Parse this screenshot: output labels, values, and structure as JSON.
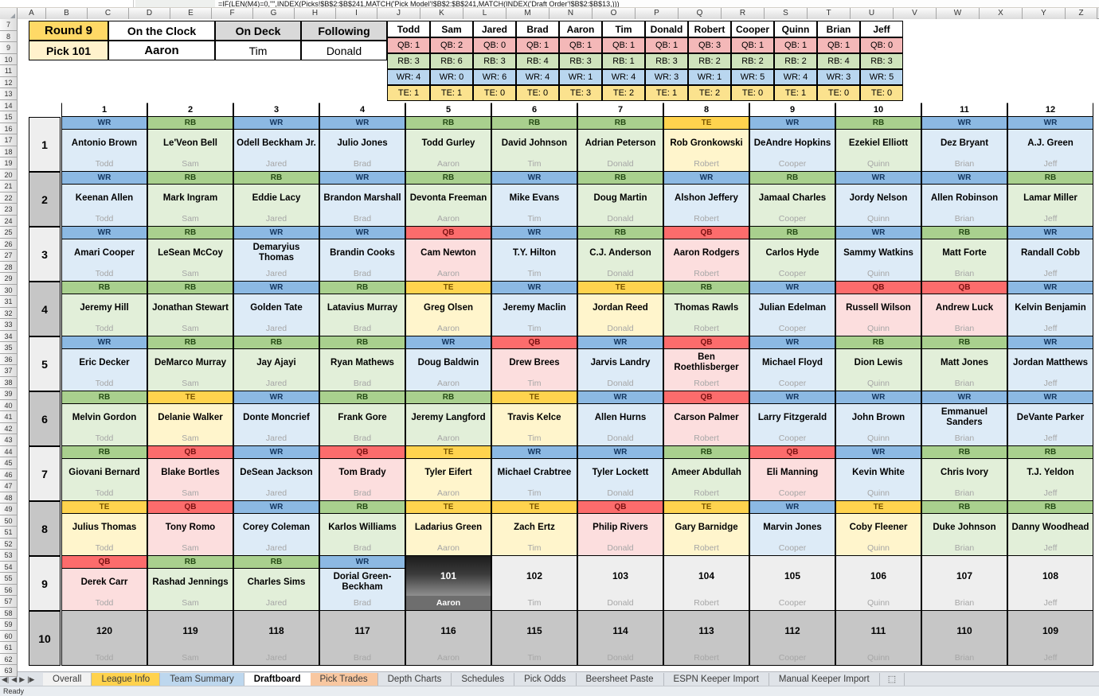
{
  "app": {
    "formula_text": "=IF(LEN(M4)=0,\"\",INDEX(Picks!$B$2:$B$241,MATCH('Pick Model'!$B$2:$B$241,MATCH(INDEX('Draft Order'!$B$2:$B$13,)))"
  },
  "columns": [
    "A",
    "B",
    "C",
    "D",
    "E",
    "F",
    "G",
    "H",
    "I",
    "J",
    "K",
    "L",
    "M",
    "N",
    "O",
    "P",
    "Q",
    "R",
    "S",
    "T",
    "U",
    "V",
    "W",
    "X",
    "Y",
    "Z"
  ],
  "status": {
    "round_label": "Round 9",
    "pick_label": "Pick 101",
    "on_the_clock_label": "On the Clock",
    "on_deck_label": "On Deck",
    "following_label": "Following",
    "on_the_clock_value": "Aaron",
    "on_deck_value": "Tim",
    "following_value": "Donald"
  },
  "roster_summary": {
    "owners": [
      "Todd",
      "Sam",
      "Jared",
      "Brad",
      "Aaron",
      "Tim",
      "Donald",
      "Robert",
      "Cooper",
      "Quinn",
      "Brian",
      "Jeff"
    ],
    "rows": [
      {
        "pos": "QB",
        "values": [
          "QB: 1",
          "QB: 2",
          "QB: 0",
          "QB: 1",
          "QB: 1",
          "QB: 1",
          "QB: 1",
          "QB: 3",
          "QB: 1",
          "QB: 1",
          "QB: 1",
          "QB: 0"
        ]
      },
      {
        "pos": "RB",
        "values": [
          "RB: 3",
          "RB: 6",
          "RB: 3",
          "RB: 4",
          "RB: 3",
          "RB: 1",
          "RB: 3",
          "RB: 2",
          "RB: 2",
          "RB: 2",
          "RB: 4",
          "RB: 3"
        ]
      },
      {
        "pos": "WR",
        "values": [
          "WR: 4",
          "WR: 0",
          "WR: 6",
          "WR: 4",
          "WR: 1",
          "WR: 4",
          "WR: 3",
          "WR: 1",
          "WR: 5",
          "WR: 4",
          "WR: 3",
          "WR: 5"
        ]
      },
      {
        "pos": "TE",
        "values": [
          "TE: 1",
          "TE: 1",
          "TE: 0",
          "TE: 0",
          "TE: 3",
          "TE: 2",
          "TE: 1",
          "TE: 2",
          "TE: 0",
          "TE: 1",
          "TE: 0",
          "TE: 0"
        ]
      }
    ]
  },
  "draftboard": {
    "column_numbers": [
      "1",
      "2",
      "3",
      "4",
      "5",
      "6",
      "7",
      "8",
      "9",
      "10",
      "11",
      "12"
    ],
    "owners": [
      "Todd",
      "Sam",
      "Jared",
      "Brad",
      "Aaron",
      "Tim",
      "Donald",
      "Robert",
      "Cooper",
      "Quinn",
      "Brian",
      "Jeff"
    ],
    "rounds": [
      {
        "round": "1",
        "picks": [
          {
            "pos": "WR",
            "name": "Antonio Brown",
            "owner": "Todd"
          },
          {
            "pos": "RB",
            "name": "Le'Veon Bell",
            "owner": "Sam"
          },
          {
            "pos": "WR",
            "name": "Odell Beckham Jr.",
            "owner": "Jared"
          },
          {
            "pos": "WR",
            "name": "Julio Jones",
            "owner": "Brad"
          },
          {
            "pos": "RB",
            "name": "Todd Gurley",
            "owner": "Aaron"
          },
          {
            "pos": "RB",
            "name": "David Johnson",
            "owner": "Tim"
          },
          {
            "pos": "RB",
            "name": "Adrian Peterson",
            "owner": "Donald"
          },
          {
            "pos": "TE",
            "name": "Rob Gronkowski",
            "owner": "Robert"
          },
          {
            "pos": "WR",
            "name": "DeAndre Hopkins",
            "owner": "Cooper"
          },
          {
            "pos": "RB",
            "name": "Ezekiel Elliott",
            "owner": "Quinn"
          },
          {
            "pos": "WR",
            "name": "Dez Bryant",
            "owner": "Brian"
          },
          {
            "pos": "WR",
            "name": "A.J. Green",
            "owner": "Jeff"
          }
        ]
      },
      {
        "round": "2",
        "picks": [
          {
            "pos": "WR",
            "name": "Keenan Allen",
            "owner": "Todd"
          },
          {
            "pos": "RB",
            "name": "Mark Ingram",
            "owner": "Sam"
          },
          {
            "pos": "RB",
            "name": "Eddie Lacy",
            "owner": "Jared"
          },
          {
            "pos": "WR",
            "name": "Brandon Marshall",
            "owner": "Brad"
          },
          {
            "pos": "RB",
            "name": "Devonta Freeman",
            "owner": "Aaron"
          },
          {
            "pos": "WR",
            "name": "Mike Evans",
            "owner": "Tim"
          },
          {
            "pos": "RB",
            "name": "Doug Martin",
            "owner": "Donald"
          },
          {
            "pos": "WR",
            "name": "Alshon Jeffery",
            "owner": "Robert"
          },
          {
            "pos": "RB",
            "name": "Jamaal Charles",
            "owner": "Cooper"
          },
          {
            "pos": "WR",
            "name": "Jordy Nelson",
            "owner": "Quinn"
          },
          {
            "pos": "WR",
            "name": "Allen Robinson",
            "owner": "Brian"
          },
          {
            "pos": "RB",
            "name": "Lamar Miller",
            "owner": "Jeff"
          }
        ]
      },
      {
        "round": "3",
        "picks": [
          {
            "pos": "WR",
            "name": "Amari Cooper",
            "owner": "Todd"
          },
          {
            "pos": "RB",
            "name": "LeSean McCoy",
            "owner": "Sam"
          },
          {
            "pos": "WR",
            "name": "Demaryius Thomas",
            "owner": "Jared"
          },
          {
            "pos": "WR",
            "name": "Brandin Cooks",
            "owner": "Brad"
          },
          {
            "pos": "QB",
            "name": "Cam Newton",
            "owner": "Aaron"
          },
          {
            "pos": "WR",
            "name": "T.Y. Hilton",
            "owner": "Tim"
          },
          {
            "pos": "RB",
            "name": "C.J. Anderson",
            "owner": "Donald"
          },
          {
            "pos": "QB",
            "name": "Aaron Rodgers",
            "owner": "Robert"
          },
          {
            "pos": "RB",
            "name": "Carlos Hyde",
            "owner": "Cooper"
          },
          {
            "pos": "WR",
            "name": "Sammy Watkins",
            "owner": "Quinn"
          },
          {
            "pos": "RB",
            "name": "Matt Forte",
            "owner": "Brian"
          },
          {
            "pos": "WR",
            "name": "Randall Cobb",
            "owner": "Jeff"
          }
        ]
      },
      {
        "round": "4",
        "picks": [
          {
            "pos": "RB",
            "name": "Jeremy Hill",
            "owner": "Todd"
          },
          {
            "pos": "RB",
            "name": "Jonathan Stewart",
            "owner": "Sam"
          },
          {
            "pos": "WR",
            "name": "Golden Tate",
            "owner": "Jared"
          },
          {
            "pos": "RB",
            "name": "Latavius Murray",
            "owner": "Brad"
          },
          {
            "pos": "TE",
            "name": "Greg Olsen",
            "owner": "Aaron"
          },
          {
            "pos": "WR",
            "name": "Jeremy Maclin",
            "owner": "Tim"
          },
          {
            "pos": "TE",
            "name": "Jordan Reed",
            "owner": "Donald"
          },
          {
            "pos": "RB",
            "name": "Thomas Rawls",
            "owner": "Robert"
          },
          {
            "pos": "WR",
            "name": "Julian Edelman",
            "owner": "Cooper"
          },
          {
            "pos": "QB",
            "name": "Russell Wilson",
            "owner": "Quinn"
          },
          {
            "pos": "QB",
            "name": "Andrew Luck",
            "owner": "Brian"
          },
          {
            "pos": "WR",
            "name": "Kelvin Benjamin",
            "owner": "Jeff"
          }
        ]
      },
      {
        "round": "5",
        "picks": [
          {
            "pos": "WR",
            "name": "Eric Decker",
            "owner": "Todd"
          },
          {
            "pos": "RB",
            "name": "DeMarco Murray",
            "owner": "Sam"
          },
          {
            "pos": "RB",
            "name": "Jay Ajayi",
            "owner": "Jared"
          },
          {
            "pos": "RB",
            "name": "Ryan Mathews",
            "owner": "Brad"
          },
          {
            "pos": "WR",
            "name": "Doug Baldwin",
            "owner": "Aaron"
          },
          {
            "pos": "QB",
            "name": "Drew Brees",
            "owner": "Tim"
          },
          {
            "pos": "WR",
            "name": "Jarvis Landry",
            "owner": "Donald"
          },
          {
            "pos": "QB",
            "name": "Ben Roethlisberger",
            "owner": "Robert"
          },
          {
            "pos": "WR",
            "name": "Michael Floyd",
            "owner": "Cooper"
          },
          {
            "pos": "RB",
            "name": "Dion Lewis",
            "owner": "Quinn"
          },
          {
            "pos": "RB",
            "name": "Matt Jones",
            "owner": "Brian"
          },
          {
            "pos": "WR",
            "name": "Jordan Matthews",
            "owner": "Jeff"
          }
        ]
      },
      {
        "round": "6",
        "picks": [
          {
            "pos": "RB",
            "name": "Melvin Gordon",
            "owner": "Todd"
          },
          {
            "pos": "TE",
            "name": "Delanie Walker",
            "owner": "Sam"
          },
          {
            "pos": "WR",
            "name": "Donte Moncrief",
            "owner": "Jared"
          },
          {
            "pos": "RB",
            "name": "Frank Gore",
            "owner": "Brad"
          },
          {
            "pos": "RB",
            "name": "Jeremy Langford",
            "owner": "Aaron"
          },
          {
            "pos": "TE",
            "name": "Travis Kelce",
            "owner": "Tim"
          },
          {
            "pos": "WR",
            "name": "Allen Hurns",
            "owner": "Donald"
          },
          {
            "pos": "QB",
            "name": "Carson Palmer",
            "owner": "Robert"
          },
          {
            "pos": "WR",
            "name": "Larry Fitzgerald",
            "owner": "Cooper"
          },
          {
            "pos": "WR",
            "name": "John Brown",
            "owner": "Quinn"
          },
          {
            "pos": "WR",
            "name": "Emmanuel Sanders",
            "owner": "Brian"
          },
          {
            "pos": "WR",
            "name": "DeVante Parker",
            "owner": "Jeff"
          }
        ]
      },
      {
        "round": "7",
        "picks": [
          {
            "pos": "RB",
            "name": "Giovani Bernard",
            "owner": "Todd"
          },
          {
            "pos": "QB",
            "name": "Blake Bortles",
            "owner": "Sam"
          },
          {
            "pos": "WR",
            "name": "DeSean Jackson",
            "owner": "Jared"
          },
          {
            "pos": "QB",
            "name": "Tom Brady",
            "owner": "Brad"
          },
          {
            "pos": "TE",
            "name": "Tyler Eifert",
            "owner": "Aaron"
          },
          {
            "pos": "WR",
            "name": "Michael Crabtree",
            "owner": "Tim"
          },
          {
            "pos": "WR",
            "name": "Tyler Lockett",
            "owner": "Donald"
          },
          {
            "pos": "RB",
            "name": "Ameer Abdullah",
            "owner": "Robert"
          },
          {
            "pos": "QB",
            "name": "Eli Manning",
            "owner": "Cooper"
          },
          {
            "pos": "WR",
            "name": "Kevin White",
            "owner": "Quinn"
          },
          {
            "pos": "RB",
            "name": "Chris Ivory",
            "owner": "Brian"
          },
          {
            "pos": "RB",
            "name": "T.J. Yeldon",
            "owner": "Jeff"
          }
        ]
      },
      {
        "round": "8",
        "picks": [
          {
            "pos": "TE",
            "name": "Julius Thomas",
            "owner": "Todd"
          },
          {
            "pos": "QB",
            "name": "Tony Romo",
            "owner": "Sam"
          },
          {
            "pos": "WR",
            "name": "Corey Coleman",
            "owner": "Jared"
          },
          {
            "pos": "RB",
            "name": "Karlos Williams",
            "owner": "Brad"
          },
          {
            "pos": "TE",
            "name": "Ladarius Green",
            "owner": "Aaron"
          },
          {
            "pos": "TE",
            "name": "Zach Ertz",
            "owner": "Tim"
          },
          {
            "pos": "QB",
            "name": "Philip Rivers",
            "owner": "Donald"
          },
          {
            "pos": "TE",
            "name": "Gary Barnidge",
            "owner": "Robert"
          },
          {
            "pos": "WR",
            "name": "Marvin Jones",
            "owner": "Cooper"
          },
          {
            "pos": "TE",
            "name": "Coby Fleener",
            "owner": "Quinn"
          },
          {
            "pos": "RB",
            "name": "Duke Johnson",
            "owner": "Brian"
          },
          {
            "pos": "RB",
            "name": "Danny Woodhead",
            "owner": "Jeff"
          }
        ]
      },
      {
        "round": "9",
        "picks": [
          {
            "pos": "QB",
            "name": "Derek Carr",
            "owner": "Todd"
          },
          {
            "pos": "RB",
            "name": "Rashad Jennings",
            "owner": "Sam"
          },
          {
            "pos": "RB",
            "name": "Charles Sims",
            "owner": "Jared"
          },
          {
            "pos": "WR",
            "name": "Dorial Green-Beckham",
            "owner": "Brad"
          },
          {
            "state": "current",
            "number": "101",
            "owner": "Aaron"
          },
          {
            "state": "future",
            "number": "102",
            "owner": "Tim"
          },
          {
            "state": "future",
            "number": "103",
            "owner": "Donald"
          },
          {
            "state": "future",
            "number": "104",
            "owner": "Robert"
          },
          {
            "state": "future",
            "number": "105",
            "owner": "Cooper"
          },
          {
            "state": "future",
            "number": "106",
            "owner": "Quinn"
          },
          {
            "state": "future",
            "number": "107",
            "owner": "Brian"
          },
          {
            "state": "future",
            "number": "108",
            "owner": "Jeff"
          }
        ]
      },
      {
        "round": "10",
        "picks": [
          {
            "state": "future-alt",
            "number": "120",
            "owner": "Todd"
          },
          {
            "state": "future-alt",
            "number": "119",
            "owner": "Sam"
          },
          {
            "state": "future-alt",
            "number": "118",
            "owner": "Jared"
          },
          {
            "state": "future-alt",
            "number": "117",
            "owner": "Brad"
          },
          {
            "state": "future-alt",
            "number": "116",
            "owner": "Aaron"
          },
          {
            "state": "future-alt",
            "number": "115",
            "owner": "Tim"
          },
          {
            "state": "future-alt",
            "number": "114",
            "owner": "Donald"
          },
          {
            "state": "future-alt",
            "number": "113",
            "owner": "Robert"
          },
          {
            "state": "future-alt",
            "number": "112",
            "owner": "Cooper"
          },
          {
            "state": "future-alt",
            "number": "111",
            "owner": "Quinn"
          },
          {
            "state": "future-alt",
            "number": "110",
            "owner": "Brian"
          },
          {
            "state": "future-alt",
            "number": "109",
            "owner": "Jeff"
          }
        ]
      }
    ]
  },
  "sheet_tabs": {
    "nav": [
      "|◀",
      "◀",
      "▶",
      "▶|"
    ],
    "tabs": [
      {
        "label": "Overall",
        "style": "t-overall",
        "active": false
      },
      {
        "label": "League Info",
        "style": "t-league",
        "active": false
      },
      {
        "label": "Team Summary",
        "style": "t-team",
        "active": false
      },
      {
        "label": "Draftboard",
        "style": "active",
        "active": true
      },
      {
        "label": "Pick Trades",
        "style": "t-trades",
        "active": false
      },
      {
        "label": "Depth Charts",
        "style": "plain",
        "active": false
      },
      {
        "label": "Schedules",
        "style": "plain",
        "active": false
      },
      {
        "label": "Pick Odds",
        "style": "plain",
        "active": false
      },
      {
        "label": "Beersheet Paste",
        "style": "plain",
        "active": false
      },
      {
        "label": "ESPN Keeper Import",
        "style": "plain",
        "active": false
      },
      {
        "label": "Manual Keeper Import",
        "style": "plain",
        "active": false
      }
    ],
    "new_sheet_icon": "new-sheet-icon"
  },
  "status_bar": {
    "text": "Ready"
  },
  "colors": {
    "qb": "#fc6c6c",
    "rb": "#a9d08e",
    "wr": "#8cb9e3",
    "te": "#ffd34e",
    "qb_body": "#fcdede",
    "rb_body": "#e2efd9",
    "wr_body": "#ddebf7",
    "te_body": "#fff5cc",
    "round_header": "#ffd966",
    "pick_header": "#fff2cc",
    "current_pick": "#3f3f3f"
  }
}
